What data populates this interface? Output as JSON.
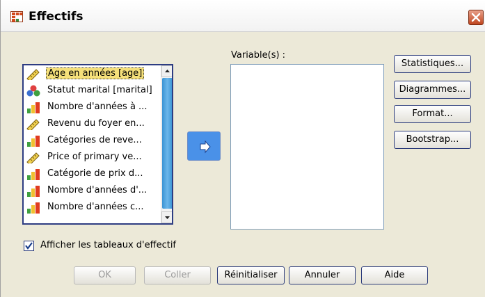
{
  "window": {
    "title": "Effectifs"
  },
  "source_list": {
    "items": [
      {
        "label": "Age en années [age]",
        "icon": "ruler-scale-icon",
        "selected": true
      },
      {
        "label": "Statut marital [marital]",
        "icon": "nominal-circles-icon",
        "selected": false
      },
      {
        "label": "Nombre d'années à ...",
        "icon": "ordinal-bars-icon",
        "selected": false
      },
      {
        "label": "Revenu du foyer en...",
        "icon": "ruler-scale-icon",
        "selected": false
      },
      {
        "label": "Catégories de reve...",
        "icon": "ordinal-bars-icon",
        "selected": false
      },
      {
        "label": "Price of primary ve...",
        "icon": "ruler-scale-icon",
        "selected": false
      },
      {
        "label": "Catégorie de prix d...",
        "icon": "ordinal-bars-icon",
        "selected": false
      },
      {
        "label": "Nombre d'années d'...",
        "icon": "ordinal-bars-icon",
        "selected": false
      },
      {
        "label": "Nombre d'années c...",
        "icon": "ordinal-bars-icon",
        "selected": false
      }
    ]
  },
  "variables": {
    "label": "Variable(s) :"
  },
  "side_buttons": {
    "statistics": "Statistiques...",
    "charts": "Diagrammes...",
    "format": "Format...",
    "bootstrap": "Bootstrap..."
  },
  "options": {
    "display_tables_label": "Afficher les tableaux d'effectif",
    "display_tables_checked": true
  },
  "footer_buttons": {
    "ok": "OK",
    "paste": "Coller",
    "reset": "Réinitialiser",
    "cancel": "Annuler",
    "help": "Aide"
  },
  "colors": {
    "accent": "#4a91e8",
    "selection": "#f5e07a",
    "border": "#2a3a7a"
  }
}
